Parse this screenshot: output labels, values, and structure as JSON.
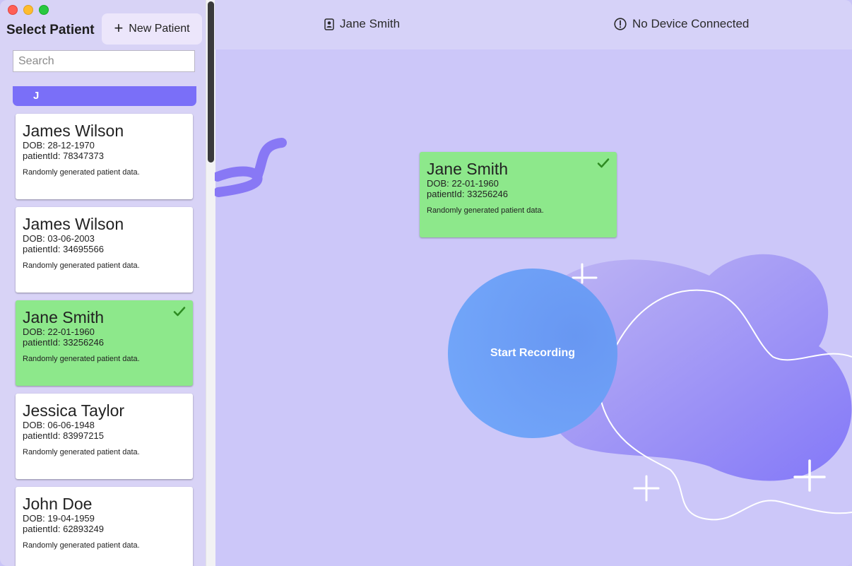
{
  "sidebar": {
    "title": "Select Patient",
    "new_patient_label": "New Patient",
    "search_placeholder": "Search",
    "section_letter": "J",
    "patients": [
      {
        "name": "James Wilson",
        "dob": "DOB: 28-12-1970",
        "patient_id": "patientId: 78347373",
        "description": "Randomly generated patient data.",
        "selected": false
      },
      {
        "name": "James Wilson",
        "dob": "DOB: 03-06-2003",
        "patient_id": "patientId: 34695566",
        "description": "Randomly generated patient data.",
        "selected": false
      },
      {
        "name": "Jane Smith",
        "dob": "DOB: 22-01-1960",
        "patient_id": "patientId: 33256246",
        "description": "Randomly generated patient data.",
        "selected": true
      },
      {
        "name": "Jessica Taylor",
        "dob": "DOB: 06-06-1948",
        "patient_id": "patientId: 83997215",
        "description": "Randomly generated patient data.",
        "selected": false
      },
      {
        "name": "John Doe",
        "dob": "DOB: 19-04-1959",
        "patient_id": "patientId: 62893249",
        "description": "Randomly generated patient data.",
        "selected": false
      }
    ]
  },
  "topbar": {
    "current_patient": "Jane Smith",
    "current_patient_icon": "contact-card-icon",
    "device_status": "No Device Connected",
    "device_status_icon": "exclamation-circle-icon"
  },
  "selected_patient": {
    "name": "Jane Smith",
    "dob": "DOB: 22-01-1960",
    "patient_id": "patientId: 33256246",
    "description": "Randomly generated patient data."
  },
  "record_button_label": "Start Recording",
  "colors": {
    "accent": "#7a6ff8",
    "selected_card": "#8de88b",
    "record_button": "#6fa2f7",
    "background": "#ccc7f9"
  }
}
